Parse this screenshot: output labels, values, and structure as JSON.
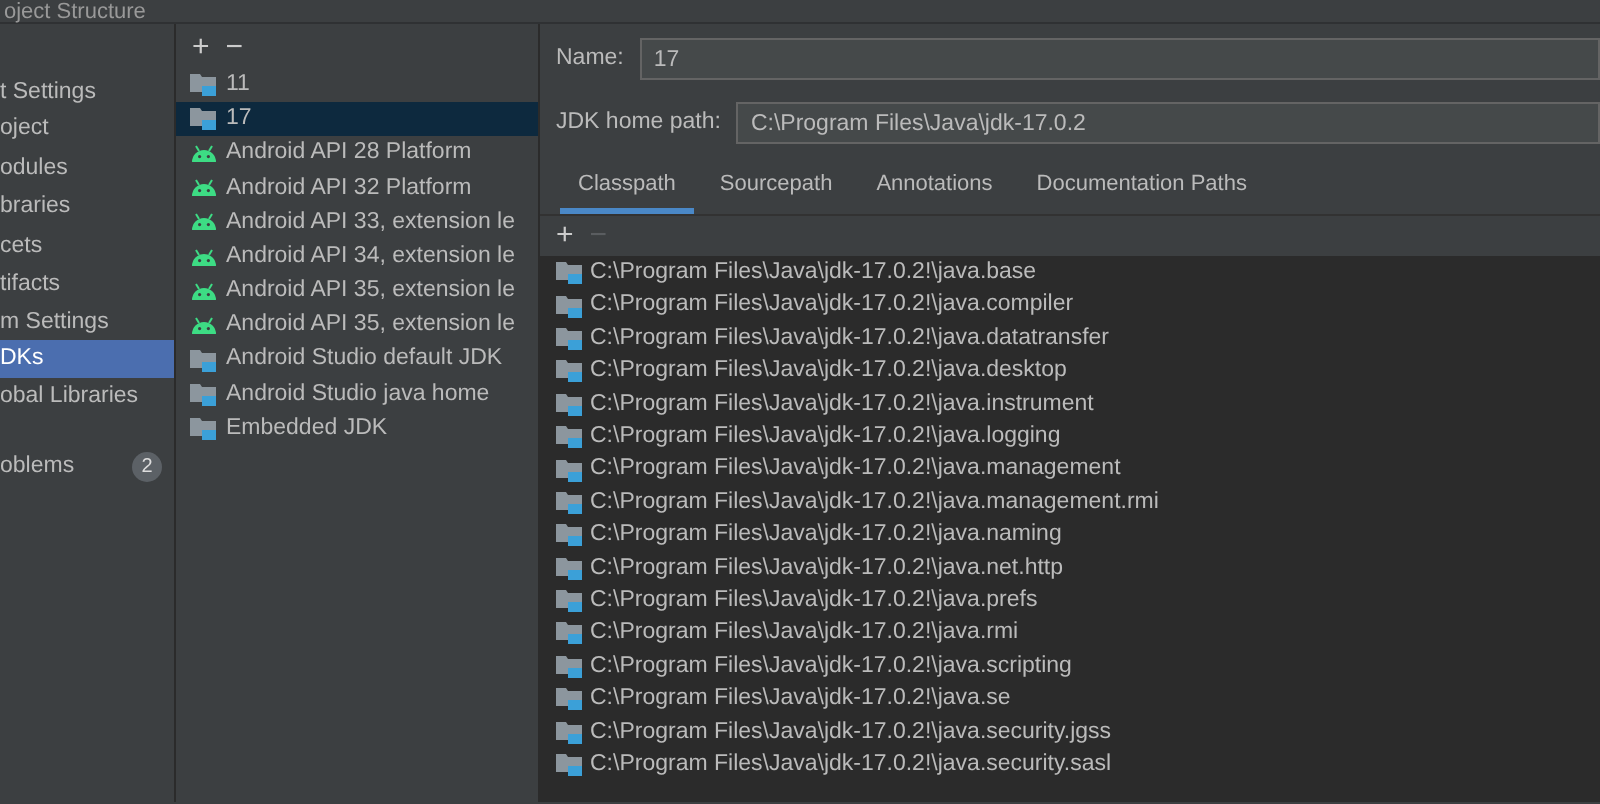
{
  "window": {
    "title": "oject Structure"
  },
  "sidebar": {
    "items": [
      {
        "kind": "header",
        "label": "t Settings"
      },
      {
        "kind": "item",
        "label": "oject",
        "selected": false
      },
      {
        "kind": "item",
        "label": "odules",
        "selected": false
      },
      {
        "kind": "item",
        "label": "braries",
        "selected": false
      },
      {
        "kind": "item",
        "label": "cets",
        "selected": false
      },
      {
        "kind": "item",
        "label": "tifacts",
        "selected": false
      },
      {
        "kind": "header",
        "label": "m Settings"
      },
      {
        "kind": "item",
        "label": "DKs",
        "selected": true
      },
      {
        "kind": "item",
        "label": "obal Libraries",
        "selected": false
      },
      {
        "kind": "spacer"
      },
      {
        "kind": "item",
        "label": "oblems",
        "badge": "2",
        "selected": false
      }
    ]
  },
  "sdk_list": {
    "toolbar": [
      "+",
      "−"
    ],
    "items": [
      {
        "kind": "jdk",
        "label": "11",
        "selected": false
      },
      {
        "kind": "jdk",
        "label": "17",
        "selected": true
      },
      {
        "kind": "android",
        "label": "Android API 28 Platform",
        "selected": false
      },
      {
        "kind": "android",
        "label": "Android API 32 Platform",
        "selected": false
      },
      {
        "kind": "android",
        "label": "Android API 33, extension le",
        "selected": false
      },
      {
        "kind": "android",
        "label": "Android API 34, extension le",
        "selected": false
      },
      {
        "kind": "android",
        "label": "Android API 35, extension le",
        "selected": false
      },
      {
        "kind": "android",
        "label": "Android API 35, extension le",
        "selected": false
      },
      {
        "kind": "jdk",
        "label": "Android Studio default JDK",
        "selected": false
      },
      {
        "kind": "jdk",
        "label": "Android Studio java home",
        "selected": false
      },
      {
        "kind": "jdk",
        "label": "Embedded JDK",
        "selected": false
      }
    ]
  },
  "details": {
    "name_label": "Name:",
    "name_value": "17",
    "home_label": "JDK home path:",
    "home_value": "C:\\Program Files\\Java\\jdk-17.0.2",
    "tabs": [
      {
        "label": "Classpath",
        "selected": true
      },
      {
        "label": "Sourcepath",
        "selected": false
      },
      {
        "label": "Annotations",
        "selected": false
      },
      {
        "label": "Documentation Paths",
        "selected": false
      }
    ],
    "toolbar": [
      {
        "label": "+",
        "disabled": false
      },
      {
        "label": "−",
        "disabled": true
      }
    ],
    "classpath": [
      "C:\\Program Files\\Java\\jdk-17.0.2!\\java.base",
      "C:\\Program Files\\Java\\jdk-17.0.2!\\java.compiler",
      "C:\\Program Files\\Java\\jdk-17.0.2!\\java.datatransfer",
      "C:\\Program Files\\Java\\jdk-17.0.2!\\java.desktop",
      "C:\\Program Files\\Java\\jdk-17.0.2!\\java.instrument",
      "C:\\Program Files\\Java\\jdk-17.0.2!\\java.logging",
      "C:\\Program Files\\Java\\jdk-17.0.2!\\java.management",
      "C:\\Program Files\\Java\\jdk-17.0.2!\\java.management.rmi",
      "C:\\Program Files\\Java\\jdk-17.0.2!\\java.naming",
      "C:\\Program Files\\Java\\jdk-17.0.2!\\java.net.http",
      "C:\\Program Files\\Java\\jdk-17.0.2!\\java.prefs",
      "C:\\Program Files\\Java\\jdk-17.0.2!\\java.rmi",
      "C:\\Program Files\\Java\\jdk-17.0.2!\\java.scripting",
      "C:\\Program Files\\Java\\jdk-17.0.2!\\java.se",
      "C:\\Program Files\\Java\\jdk-17.0.2!\\java.security.jgss",
      "C:\\Program Files\\Java\\jdk-17.0.2!\\java.security.sasl"
    ]
  }
}
